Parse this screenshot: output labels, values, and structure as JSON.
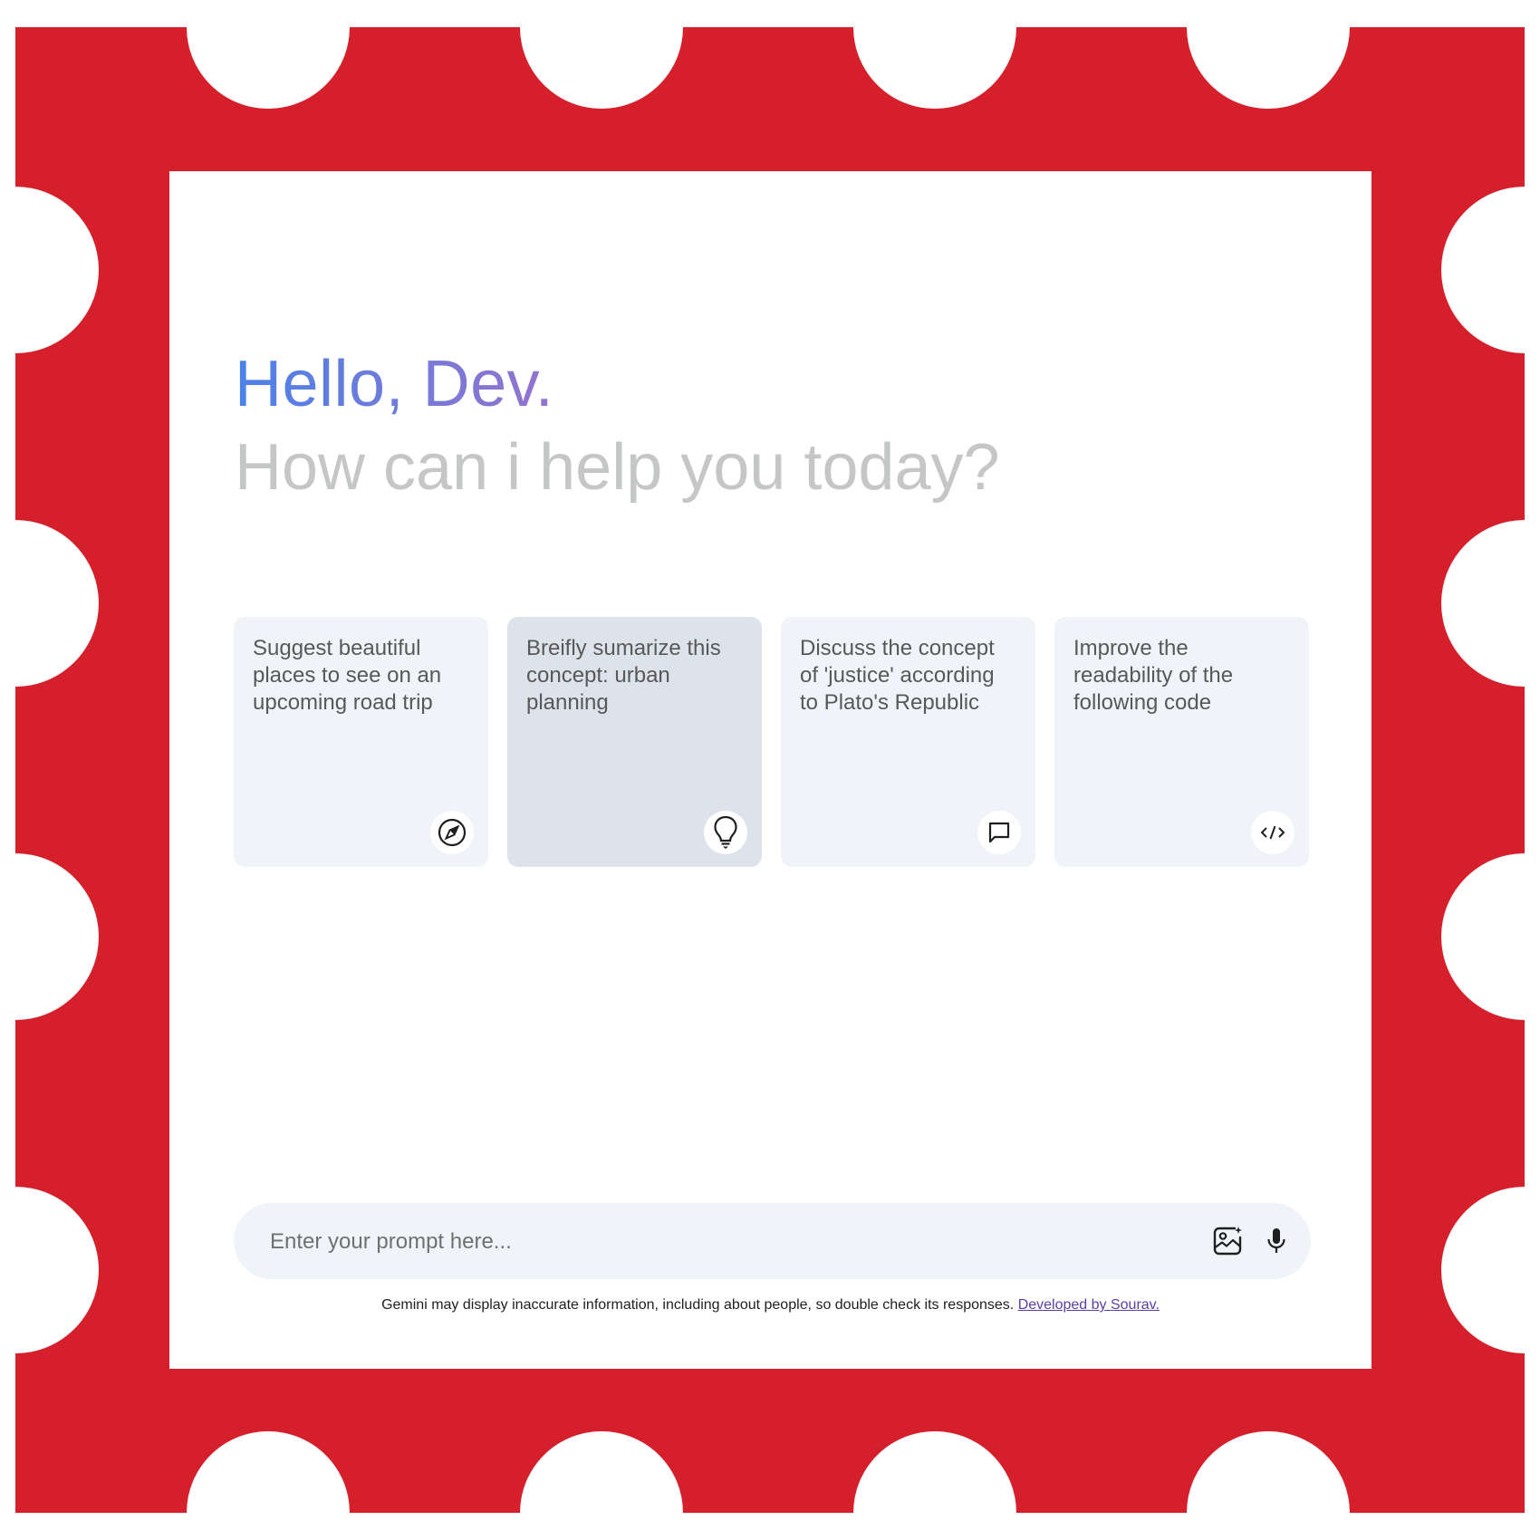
{
  "greeting": {
    "hello": "Hello, Dev.",
    "subtitle": "How can i help you today?"
  },
  "cards": [
    {
      "text": "Suggest beautiful places to see on an upcoming road trip",
      "icon": "compass-icon"
    },
    {
      "text": "Breifly sumarize this concept: urban planning",
      "icon": "bulb-icon"
    },
    {
      "text": "Discuss the concept of 'justice' according to Plato's Republic",
      "icon": "message-icon"
    },
    {
      "text": "Improve the readability of the following code",
      "icon": "code-icon"
    }
  ],
  "prompt": {
    "placeholder": "Enter your prompt here...",
    "value": ""
  },
  "footer": {
    "disclaimer": "Gemini may display inaccurate information, including about people, so double check its responses.",
    "link_text": "Developed by Sourav."
  },
  "colors": {
    "stamp_red": "#d51f2a",
    "card_bg": "#f0f4f9",
    "card_hover_bg": "#dde3ea",
    "greeting_gradient": [
      "#4b82e8",
      "#9b72cb",
      "#d96570"
    ],
    "subtitle_gray": "#c4c7c5"
  }
}
